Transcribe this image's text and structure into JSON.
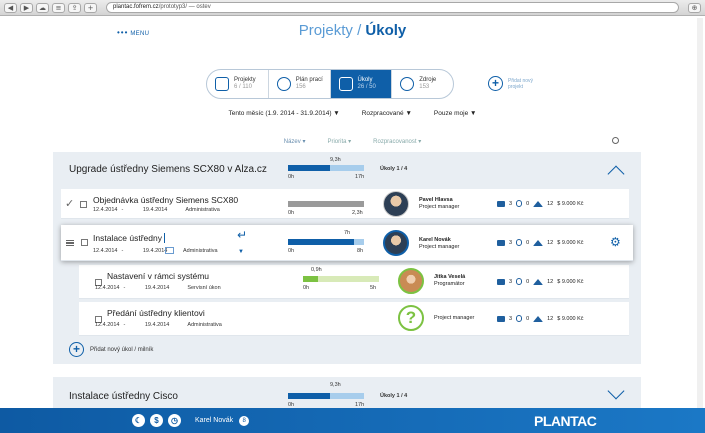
{
  "browser": {
    "url_host": "plantac.fofrem.cz",
    "url_path": "/prototyp3/ — ",
    "url_tail": "ostev"
  },
  "nav": {
    "menu_label": "MENU",
    "crumb_parent": "Projekty",
    "crumb_sep": "/",
    "crumb_current": "Úkoly"
  },
  "steps": [
    {
      "label": "Projekty",
      "sub": "6 / 110",
      "icon": "folder-icon"
    },
    {
      "label": "Plán prací",
      "sub": "156",
      "icon": "clock-icon"
    },
    {
      "label": "Úkoly",
      "sub": "26 / 50",
      "icon": "checkbox-icon"
    },
    {
      "label": "Zdroje",
      "sub": "153",
      "icon": "person-icon"
    }
  ],
  "add_project": {
    "line1": "Přidat nový",
    "line2": "projekt"
  },
  "filters": {
    "period": "Tento měsíc (1.9. 2014 - 31.9.2014)",
    "state": "Rozpracované",
    "mine": "Pouze moje"
  },
  "sorts": {
    "name": "Název",
    "priority": "Priorita",
    "progress": "Rozpracovanost"
  },
  "project1": {
    "title": "Upgrade ústředny Siemens SCX80 v Alza.cz",
    "hours": "9,3h",
    "zero": "0h",
    "max": "17h",
    "progress": 0.55,
    "tasks": "Úkoly 1 / 4"
  },
  "tasks": [
    {
      "title": "Objednávka ústředny Siemens SCX80",
      "start": "12.4.2014",
      "end": "19.4.2014",
      "category": "Administrativa",
      "bar_zero": "0h",
      "bar_max": "2,3h",
      "progress": 1.0,
      "person_name": "Pavel Hlavsa",
      "person_role": "Project manager",
      "comments": "3",
      "attachments": "0",
      "subtasks": "12",
      "cost": "$ 9.000 Kč"
    },
    {
      "title": "Instalace ústředny",
      "start": "12.4.2014",
      "end": "19.4.2014",
      "category": "Administrativa",
      "bar_top": "7h",
      "bar_zero": "0h",
      "bar_max": "8h",
      "progress": 0.87,
      "person_name": "Karel Novák",
      "person_role": "Project manager",
      "comments": "3",
      "attachments": "0",
      "subtasks": "12",
      "cost": "$ 9.000 Kč"
    },
    {
      "title": "Nastavení v rámci systému",
      "start": "12.4.2014",
      "end": "19.4.2014",
      "category": "Servisní úkon",
      "bar_top": "0,9h",
      "bar_zero": "0h",
      "bar_max": "5h",
      "progress": 0.2,
      "person_name": "Jitka Veselá",
      "person_role": "Programátor",
      "comments": "3",
      "attachments": "0",
      "subtasks": "12",
      "cost": "$ 9.000 Kč"
    },
    {
      "title": "Předání ústředny klientovi",
      "start": "12.4.2014",
      "end": "19.4.2014",
      "category": "Administrativa",
      "person_role": "Project manager",
      "comments": "3",
      "attachments": "0",
      "subtasks": "12",
      "cost": "$ 9.000 Kč"
    }
  ],
  "add_task": "Přidat nový úkol / milník",
  "project2": {
    "title": "Instalace ústředny Cisco",
    "hours": "9,3h",
    "zero": "0h",
    "max": "17h",
    "progress": 0.55,
    "tasks": "Úkoly 1 / 4"
  },
  "bottom": {
    "user": "Karel Novák",
    "badge": "8",
    "logo": "PLANTAC"
  },
  "colors": {
    "primary": "#0f5fa8",
    "panel": "#e9eef3",
    "green": "#7cc242"
  }
}
